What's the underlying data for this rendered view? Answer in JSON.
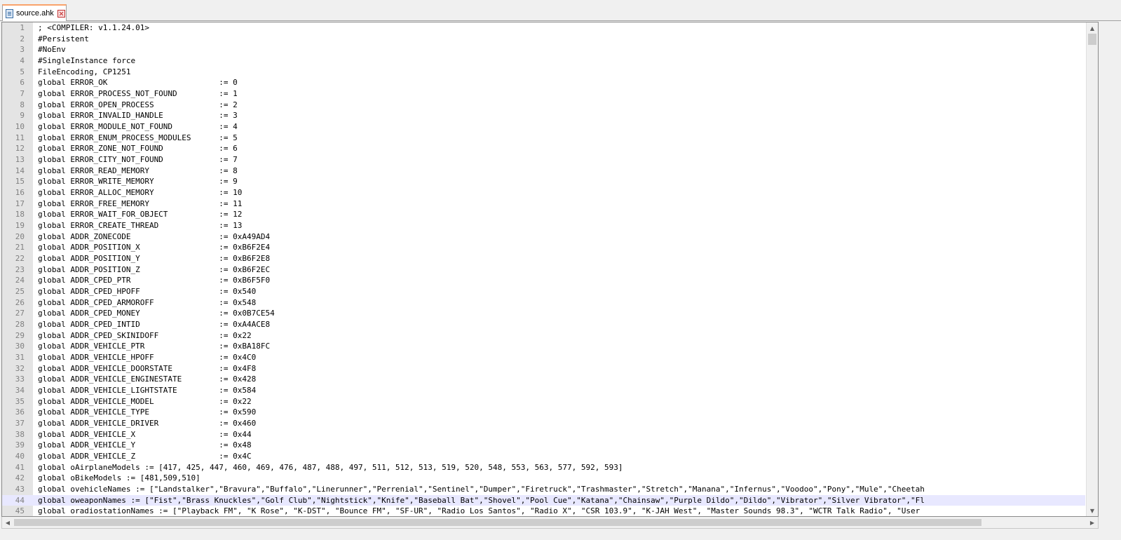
{
  "tab": {
    "label": "source.ahk",
    "icon": "file-icon",
    "close_icon": "close-icon"
  },
  "editor": {
    "current_line": 44,
    "lines": [
      "; <COMPILER: v1.1.24.01>",
      "#Persistent",
      "#NoEnv",
      "#SingleInstance force",
      "FileEncoding, CP1251",
      "global ERROR_OK                        := 0",
      "global ERROR_PROCESS_NOT_FOUND         := 1",
      "global ERROR_OPEN_PROCESS              := 2",
      "global ERROR_INVALID_HANDLE            := 3",
      "global ERROR_MODULE_NOT_FOUND          := 4",
      "global ERROR_ENUM_PROCESS_MODULES      := 5",
      "global ERROR_ZONE_NOT_FOUND            := 6",
      "global ERROR_CITY_NOT_FOUND            := 7",
      "global ERROR_READ_MEMORY               := 8",
      "global ERROR_WRITE_MEMORY              := 9",
      "global ERROR_ALLOC_MEMORY              := 10",
      "global ERROR_FREE_MEMORY               := 11",
      "global ERROR_WAIT_FOR_OBJECT           := 12",
      "global ERROR_CREATE_THREAD             := 13",
      "global ADDR_ZONECODE                   := 0xA49AD4",
      "global ADDR_POSITION_X                 := 0xB6F2E4",
      "global ADDR_POSITION_Y                 := 0xB6F2E8",
      "global ADDR_POSITION_Z                 := 0xB6F2EC",
      "global ADDR_CPED_PTR                   := 0xB6F5F0",
      "global ADDR_CPED_HPOFF                 := 0x540",
      "global ADDR_CPED_ARMOROFF              := 0x548",
      "global ADDR_CPED_MONEY                 := 0x0B7CE54",
      "global ADDR_CPED_INTID                 := 0xA4ACE8",
      "global ADDR_CPED_SKINIDOFF             := 0x22",
      "global ADDR_VEHICLE_PTR                := 0xBA18FC",
      "global ADDR_VEHICLE_HPOFF              := 0x4C0",
      "global ADDR_VEHICLE_DOORSTATE          := 0x4F8",
      "global ADDR_VEHICLE_ENGINESTATE        := 0x428",
      "global ADDR_VEHICLE_LIGHTSTATE         := 0x584",
      "global ADDR_VEHICLE_MODEL              := 0x22",
      "global ADDR_VEHICLE_TYPE               := 0x590",
      "global ADDR_VEHICLE_DRIVER             := 0x460",
      "global ADDR_VEHICLE_X                  := 0x44",
      "global ADDR_VEHICLE_Y                  := 0x48",
      "global ADDR_VEHICLE_Z                  := 0x4C",
      "global oAirplaneModels := [417, 425, 447, 460, 469, 476, 487, 488, 497, 511, 512, 513, 519, 520, 548, 553, 563, 577, 592, 593]",
      "global oBikeModels := [481,509,510]",
      "global ovehicleNames := [\"Landstalker\",\"Bravura\",\"Buffalo\",\"Linerunner\",\"Perrenial\",\"Sentinel\",\"Dumper\",\"Firetruck\",\"Trashmaster\",\"Stretch\",\"Manana\",\"Infernus\",\"Voodoo\",\"Pony\",\"Mule\",\"Cheetah",
      "global oweaponNames := [\"Fist\",\"Brass Knuckles\",\"Golf Club\",\"Nightstick\",\"Knife\",\"Baseball Bat\",\"Shovel\",\"Pool Cue\",\"Katana\",\"Chainsaw\",\"Purple Dildo\",\"Dildo\",\"Vibrator\",\"Silver Vibrator\",\"Fl",
      "global oradiostationNames := [\"Playback FM\", \"K Rose\", \"K-DST\", \"Bounce FM\", \"SF-UR\", \"Radio Los Santos\", \"Radio X\", \"CSR 103.9\", \"K-JAH West\", \"Master Sounds 98.3\", \"WCTR Talk Radio\", \"User"
    ]
  },
  "scrollbars": {
    "up_arrow": "▲",
    "down_arrow": "▼",
    "left_arrow": "◀",
    "right_arrow": "▶"
  }
}
